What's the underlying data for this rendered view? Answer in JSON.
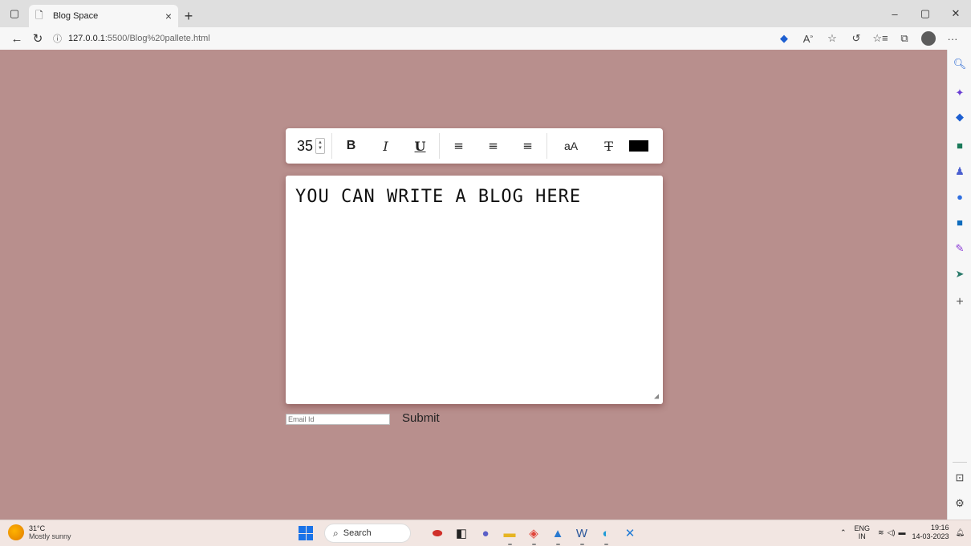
{
  "browser": {
    "tab_title": "Blog Space",
    "url_host": "127.0.0.1",
    "url_path": ":5500/Blog%20pallete.html",
    "toolbar_icons": [
      "tag-icon",
      "read-aloud-icon",
      "favorite-star-icon",
      "refresh-extension-icon",
      "favorites-icon",
      "collections-icon",
      "profile-avatar",
      "more-icon"
    ]
  },
  "sidebar": {
    "icons": [
      "search-icon",
      "copilot-icon",
      "tag-icon",
      "briefcase-icon",
      "games-icon",
      "office-icon",
      "outlook-icon",
      "designer-icon",
      "send-icon",
      "add-icon",
      "split-screen-icon",
      "settings-icon"
    ]
  },
  "toolbar": {
    "font_size": "35",
    "bold_label": "B",
    "italic_label": "I",
    "underline_label": "U",
    "case_label": "aA",
    "text_color": "#000000"
  },
  "editor": {
    "content": "YOU CAN WRITE A BLOG HERE"
  },
  "form": {
    "email_placeholder": "Email Id",
    "submit_label": "Submit"
  },
  "taskbar": {
    "temperature": "31°C",
    "weather": "Mostly sunny",
    "search_label": "Search",
    "lang_line1": "ENG",
    "lang_line2": "IN",
    "time": "19:16",
    "date": "14-03-2023"
  },
  "colors": {
    "page_background": "#b88f8d",
    "panel": "#ffffff"
  }
}
